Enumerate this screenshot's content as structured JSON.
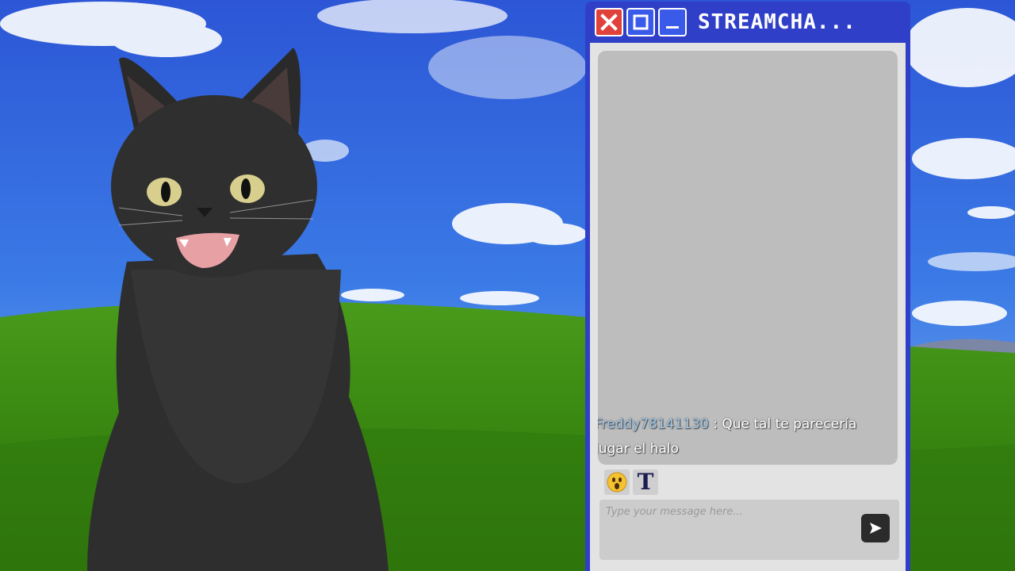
{
  "chat_window": {
    "title": "STREAMCHA...",
    "buttons": {
      "close_icon": "x-icon",
      "maximize_icon": "square-icon",
      "minimize_icon": "underscore-icon"
    }
  },
  "messages": [
    {
      "username": "Freddy78141130",
      "separator": " : ",
      "text": "Que tal te parecería jugar el halo"
    }
  ],
  "toolbar": {
    "emoji_icon": "surprised-face-icon",
    "text_tool_label": "T"
  },
  "composer": {
    "placeholder": "Type your message here...",
    "value": "",
    "send_icon": "send-arrow-icon"
  },
  "colors": {
    "window_frame": "#2f3fc8",
    "close_button": "#e0413b",
    "username": "#9dc6e8",
    "chat_background": "#bdbdbd"
  }
}
